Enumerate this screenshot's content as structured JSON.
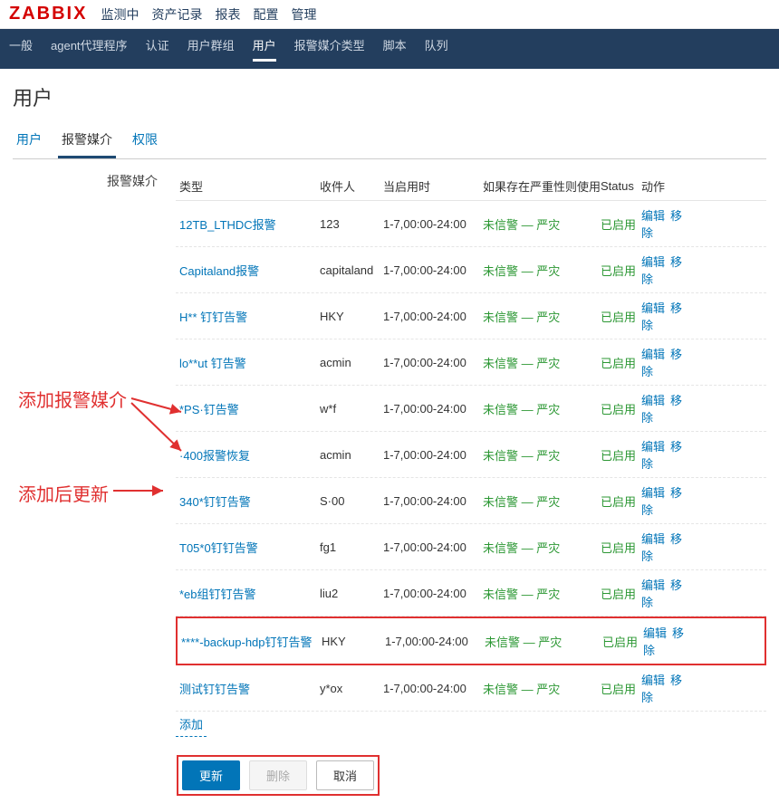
{
  "logo": "ZABBIX",
  "main_nav": [
    "监测中",
    "资产记录",
    "报表",
    "配置",
    "管理"
  ],
  "sub_nav": [
    "一般",
    "agent代理程序",
    "认证",
    "用户群组",
    "用户",
    "报警媒介类型",
    "脚本",
    "队列"
  ],
  "sub_nav_active": 4,
  "page_title": "用户",
  "tabs": [
    "用户",
    "报警媒介",
    "权限"
  ],
  "tabs_active": 1,
  "side_label": "报警媒介",
  "headers": {
    "type": "类型",
    "sendto": "收件人",
    "when": "当启用时",
    "severity": "如果存在严重性则使用",
    "status": "Status",
    "action": "动作"
  },
  "status_label": "已启用",
  "action_edit": "编辑",
  "action_remove": "移除",
  "severity_text": "未信警 — 严灾",
  "add_label": "添加",
  "rows": [
    {
      "type": "12TB_LTHDC报警",
      "sendto": "123",
      "when": "1-7,00:00-24:00"
    },
    {
      "type": "Capitaland报警",
      "sendto": "capitaland",
      "when": "1-7,00:00-24:00"
    },
    {
      "type": "H** 钉钉告警",
      "sendto": "HKY",
      "when": "1-7,00:00-24:00"
    },
    {
      "type": "lo**ut 钉告警",
      "sendto": "acmin",
      "when": "1-7,00:00-24:00"
    },
    {
      "type": "*PS·钉告警",
      "sendto": "w*f",
      "when": "1-7,00:00-24:00"
    },
    {
      "type": "·400报警恢复",
      "sendto": "acmin",
      "when": "1-7,00:00-24:00"
    },
    {
      "type": "340*钉钉告警",
      "sendto": "S·00",
      "when": "1-7,00:00-24:00"
    },
    {
      "type": "T05*0钉钉告警",
      "sendto": "fg1",
      "when": "1-7,00:00-24:00"
    },
    {
      "type": "*eb组钉钉告警",
      "sendto": "liu2",
      "when": "1-7,00:00-24:00"
    },
    {
      "type": "****-backup-hdp钉钉告警",
      "sendto": "HKY",
      "when": "1-7,00:00-24:00",
      "highlight": true
    },
    {
      "type": "测试钉钉告警",
      "sendto": "y*ox",
      "when": "1-7,00:00-24:00"
    }
  ],
  "buttons": {
    "update": "更新",
    "delete": "删除",
    "cancel": "取消"
  },
  "annotations": {
    "note1": "添加报警媒介",
    "note2": "添加后更新"
  }
}
